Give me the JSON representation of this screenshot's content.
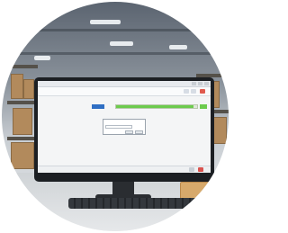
{
  "app": {
    "window_title": "",
    "window_buttons": [
      "",
      "",
      ""
    ]
  },
  "toolbar": {
    "items": [
      "",
      "",
      "",
      ""
    ],
    "icons": [
      "doc-icon",
      "folder-icon",
      "close-icon"
    ]
  },
  "row": {
    "cells": [
      "",
      "",
      ""
    ]
  },
  "progress": {
    "fraction": 0.95,
    "color": "#6ccb4d"
  },
  "dialog": {
    "title": "",
    "ok_label": "",
    "cancel_label": ""
  },
  "statusbar": {
    "text": "",
    "icons": [
      "network-icon",
      "warning-icon"
    ]
  },
  "colors": {
    "accent": "#2f6fc4",
    "progress": "#6ccb4d",
    "alert": "#e05a4e"
  }
}
